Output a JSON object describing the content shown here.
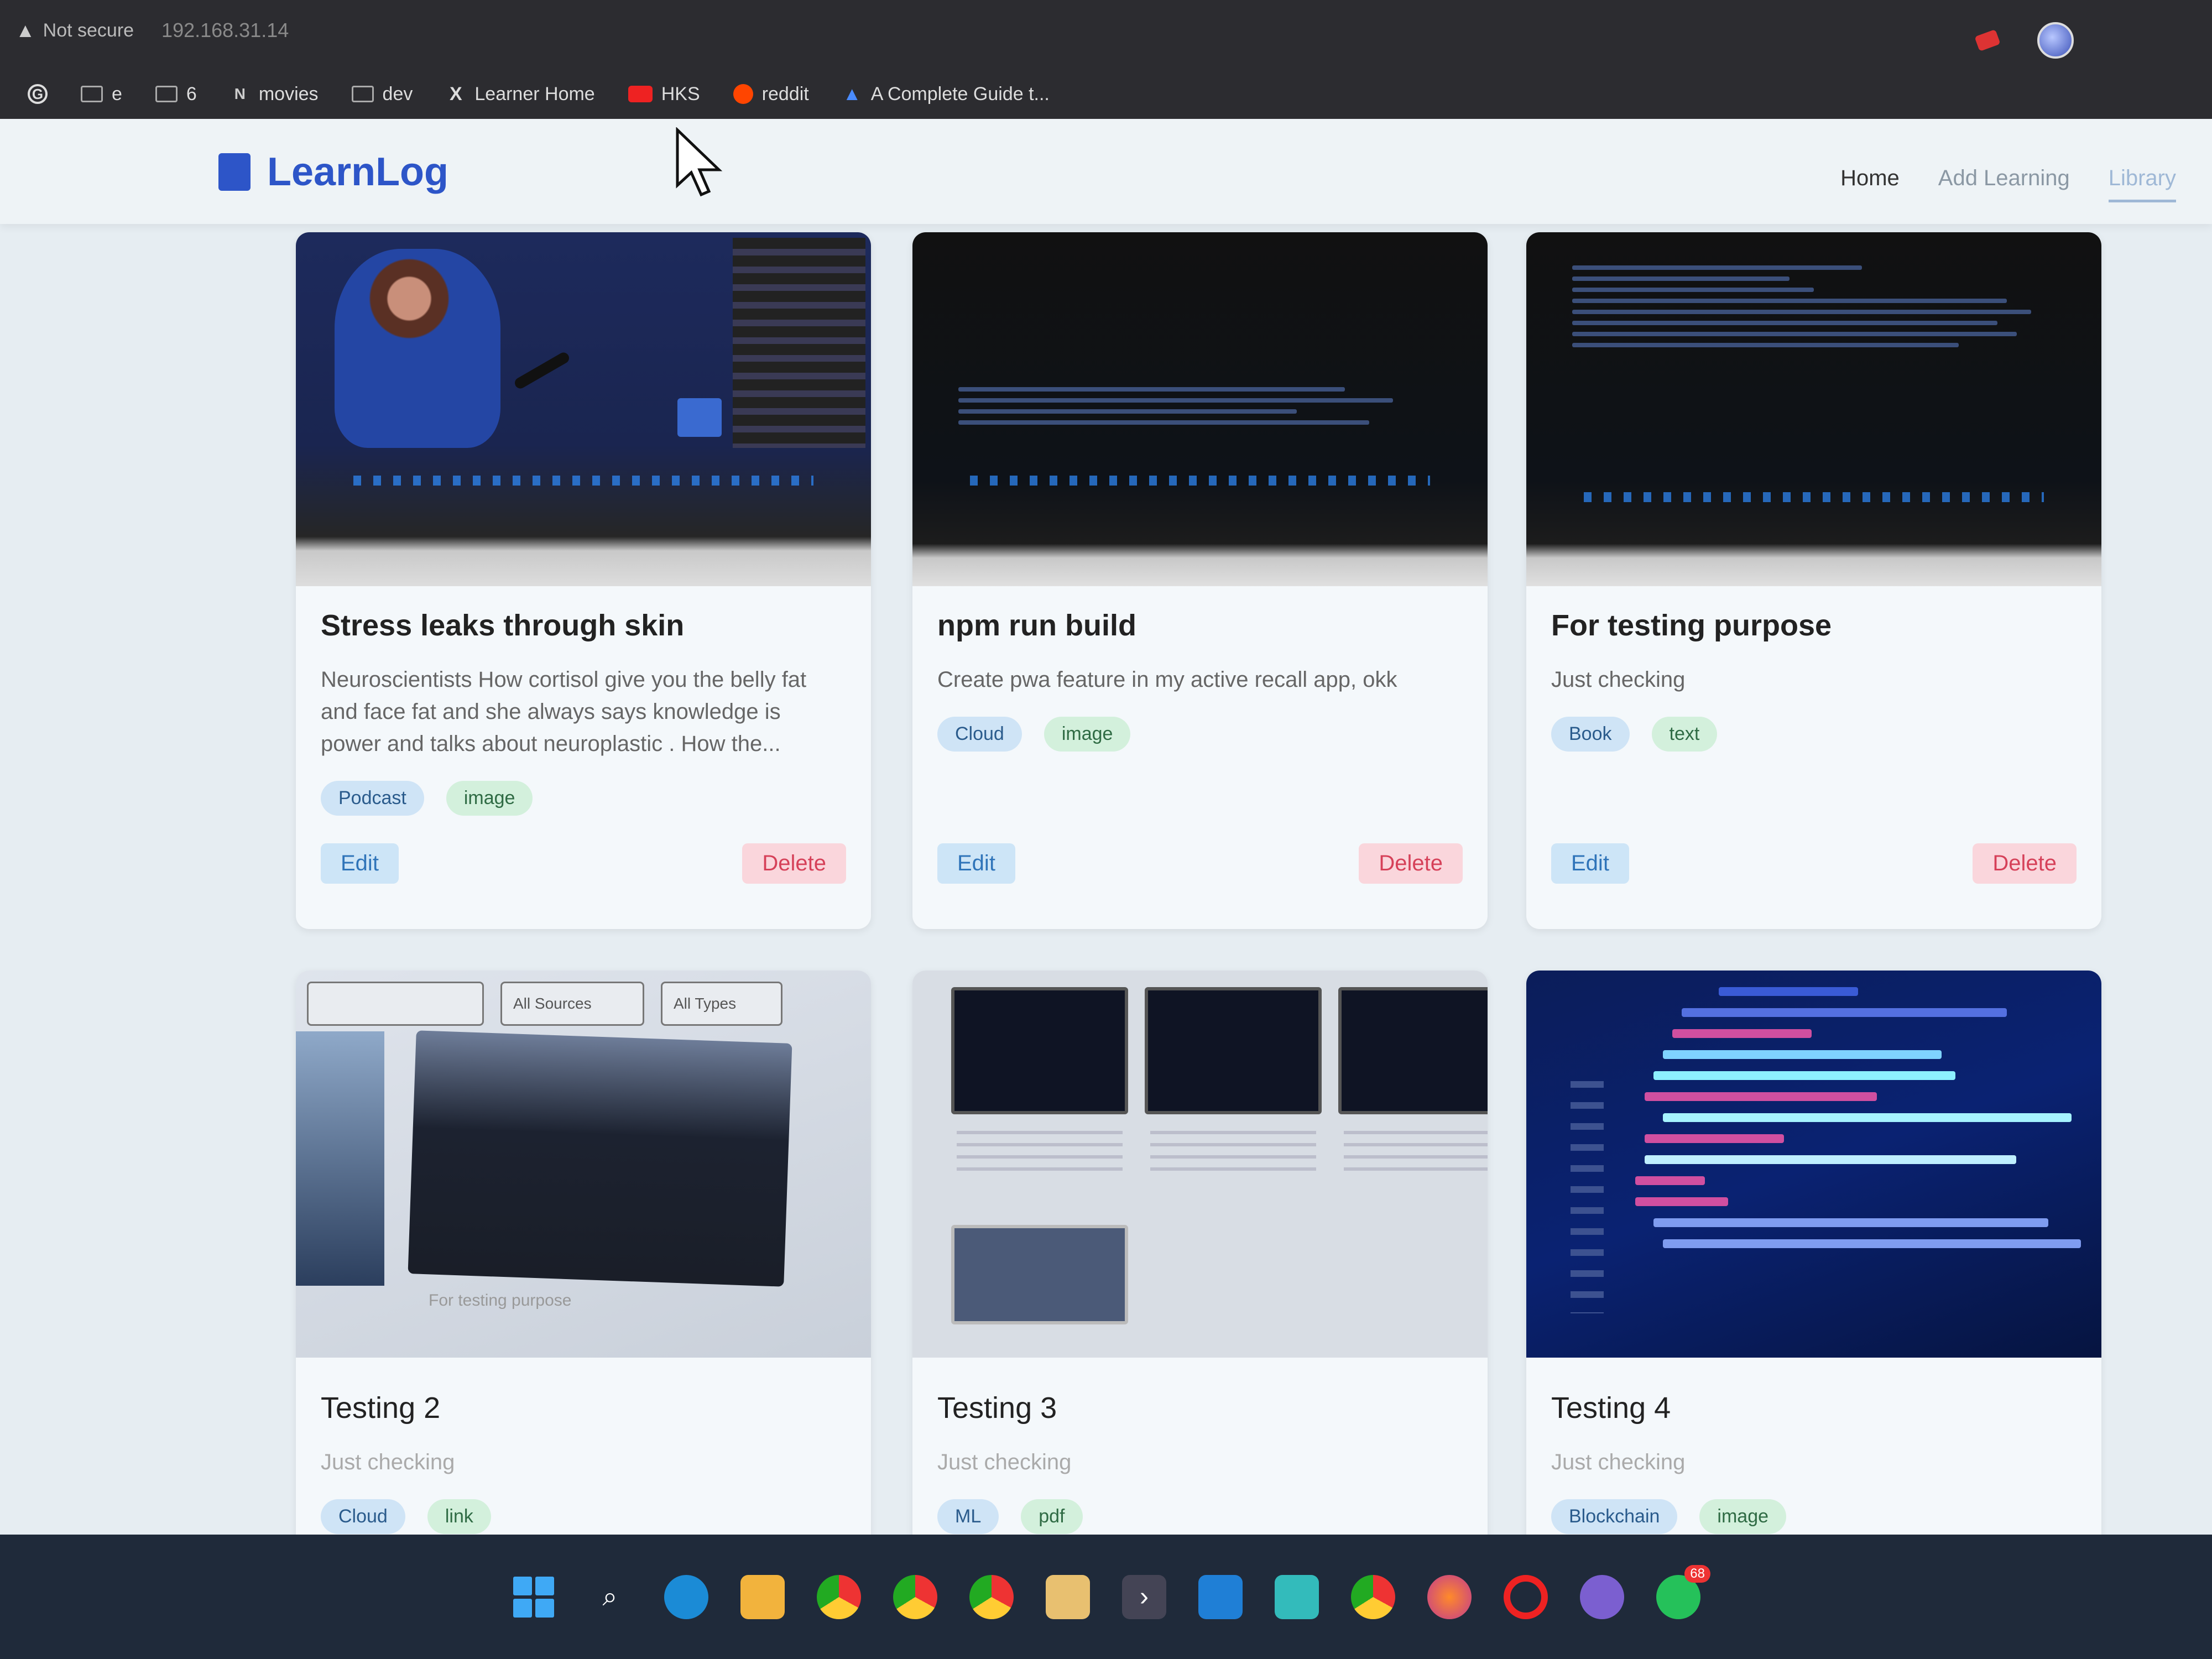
{
  "browser": {
    "security_label": "Not secure",
    "url": "192.168.31.14",
    "bookmarks": [
      {
        "label": "e",
        "icon": "folder-icon"
      },
      {
        "label": "6",
        "icon": "folder-icon"
      },
      {
        "label": "movies",
        "icon": "notion-icon"
      },
      {
        "label": "dev",
        "icon": "folder-icon"
      },
      {
        "label": "Learner Home",
        "icon": "x-icon"
      },
      {
        "label": "HKS",
        "icon": "youtube-icon"
      },
      {
        "label": "reddit",
        "icon": "reddit-icon"
      },
      {
        "label": "A Complete Guide t...",
        "icon": "a-icon"
      }
    ]
  },
  "app": {
    "brand": "LearnLog",
    "nav": [
      "Home",
      "Add Learning",
      "Library"
    ],
    "active_nav": "Library"
  },
  "cards": [
    {
      "title": "Stress leaks through skin",
      "description": "Neuroscientists How cortisol give you the belly fat and face fat and she always says knowledge is power and talks about neuroplastic . How the...",
      "tags": [
        "Podcast",
        "image"
      ],
      "edit_label": "Edit",
      "delete_label": "Delete"
    },
    {
      "title": "npm run build",
      "description": "Create pwa feature in my active recall app, okk",
      "tags": [
        "Cloud",
        "image"
      ],
      "edit_label": "Edit",
      "delete_label": "Delete"
    },
    {
      "title": "For testing purpose",
      "description": "Just checking",
      "tags": [
        "Book",
        "text"
      ],
      "edit_label": "Edit",
      "delete_label": "Delete"
    },
    {
      "title": "Testing 2",
      "description": "Just checking",
      "tags": [
        "Cloud",
        "link"
      ],
      "thumb_labels": [
        "All Sources",
        "All Types",
        "For testing purpose"
      ]
    },
    {
      "title": "Testing 3",
      "description": "Just checking",
      "tags": [
        "ML",
        "pdf"
      ]
    },
    {
      "title": "Testing 4",
      "description": "Just checking",
      "tags": [
        "Blockchain",
        "image"
      ]
    }
  ],
  "taskbar": {
    "apps": [
      "windows-start-icon",
      "search-icon",
      "edge-icon",
      "file-explorer-icon",
      "chrome-icon",
      "chrome-icon",
      "chrome-icon",
      "store-icon",
      "terminal-icon",
      "vscode-icon",
      "app-icon",
      "chrome-icon",
      "firefox-icon",
      "opera-icon",
      "app-icon",
      "whatsapp-icon"
    ],
    "whatsapp_badge": "68"
  },
  "colors": {
    "brand": "#2d55c8",
    "edit_bg": "#cde5f7",
    "delete_bg": "#fad6dc",
    "tag_blue": "#cfe4f6",
    "tag_green": "#d3f0dc"
  }
}
